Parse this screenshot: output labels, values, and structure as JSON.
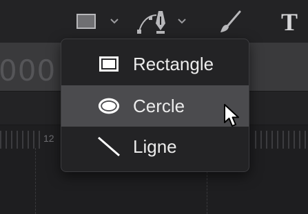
{
  "toolbar": {
    "shape_tool_icon": "rectangle-icon",
    "pen_tool_icon": "pen-tool-icon",
    "brush_tool_icon": "brush-icon",
    "text_tool_label": "T"
  },
  "track": {
    "digits": "000"
  },
  "ruler": {
    "label": "12"
  },
  "shape_menu": {
    "items": [
      {
        "label": "Rectangle",
        "icon": "rectangle-icon",
        "selected": false
      },
      {
        "label": "Cercle",
        "icon": "ellipse-icon",
        "selected": true
      },
      {
        "label": "Ligne",
        "icon": "line-icon",
        "selected": false
      }
    ]
  },
  "colors": {
    "background": "#1b1b1c",
    "menu_background": "#232325",
    "menu_highlight": "#4b4b4e",
    "text": "#ececec"
  }
}
